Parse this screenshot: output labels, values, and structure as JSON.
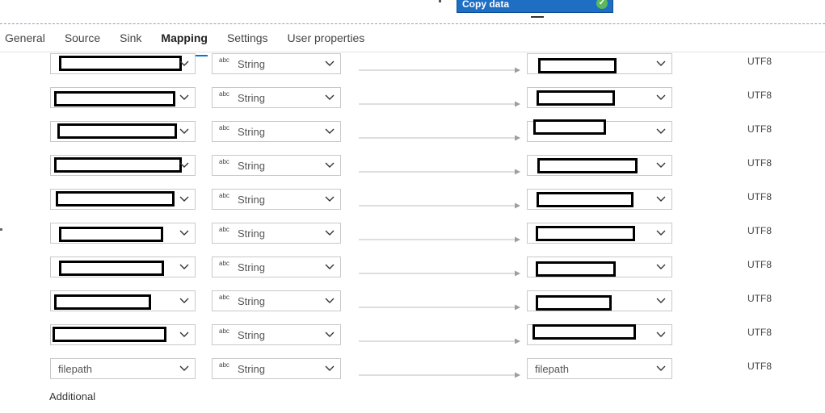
{
  "activity": {
    "title": "Copy data",
    "status_icon": "check-circle-icon"
  },
  "tabs": [
    {
      "label": "General",
      "active": false
    },
    {
      "label": "Source",
      "active": false
    },
    {
      "label": "Sink",
      "active": false
    },
    {
      "label": "Mapping",
      "active": true
    },
    {
      "label": "Settings",
      "active": false
    },
    {
      "label": "User properties",
      "active": false
    }
  ],
  "type_badge": "abc",
  "mappings": [
    {
      "source": "",
      "type": "String",
      "destination": "",
      "encoding": "UTF8",
      "redacted": true
    },
    {
      "source": "",
      "type": "String",
      "destination": "",
      "encoding": "UTF8",
      "redacted": true
    },
    {
      "source": "",
      "type": "String",
      "destination": "",
      "encoding": "UTF8",
      "redacted": true
    },
    {
      "source": "",
      "type": "String",
      "destination": "",
      "encoding": "UTF8",
      "redacted": true
    },
    {
      "source": "",
      "type": "String",
      "destination": "",
      "encoding": "UTF8",
      "redacted": true
    },
    {
      "source": "",
      "type": "String",
      "destination": "",
      "encoding": "UTF8",
      "redacted": true
    },
    {
      "source": "",
      "type": "String",
      "destination": "",
      "encoding": "UTF8",
      "redacted": true
    },
    {
      "source": "",
      "type": "String",
      "destination": "",
      "encoding": "UTF8",
      "redacted": true
    },
    {
      "source": "",
      "type": "String",
      "destination": "",
      "encoding": "UTF8",
      "redacted": true
    },
    {
      "source": "filepath",
      "type": "String",
      "destination": "filepath",
      "encoding": "UTF8",
      "redacted": false
    }
  ],
  "footer": {
    "additional_label": "Additional"
  },
  "colors": {
    "accent": "#0078d4",
    "activity_bg": "#1e6fc4",
    "success": "#5cb85c"
  }
}
